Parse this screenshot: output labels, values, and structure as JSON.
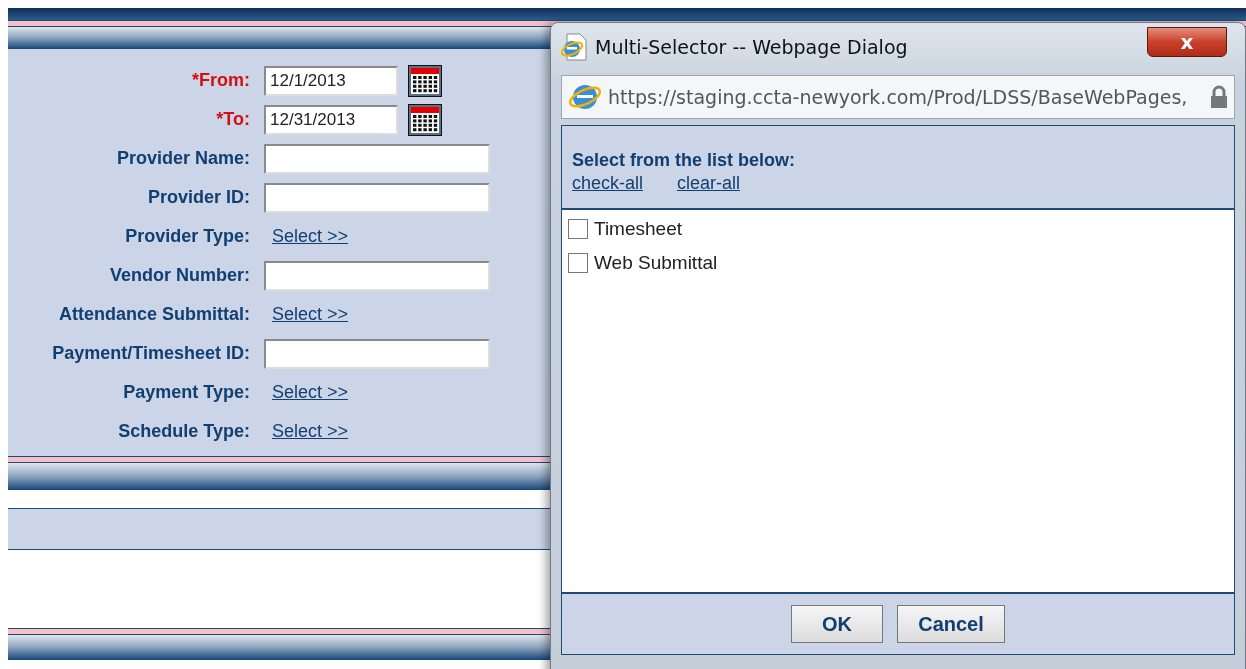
{
  "form": {
    "fields": [
      {
        "label": "*From:",
        "required": true,
        "kind": "date",
        "value": "12/1/2013"
      },
      {
        "label": "*To:",
        "required": true,
        "kind": "date",
        "value": "12/31/2013"
      },
      {
        "label": "Provider Name:",
        "required": false,
        "kind": "text"
      },
      {
        "label": "Provider ID:",
        "required": false,
        "kind": "text"
      },
      {
        "label": "Provider Type:",
        "required": false,
        "kind": "select",
        "link": "Select >>"
      },
      {
        "label": "Vendor Number:",
        "required": false,
        "kind": "text"
      },
      {
        "label": "Attendance Submittal:",
        "required": false,
        "kind": "select",
        "link": "Select >>"
      },
      {
        "label": "Payment/Timesheet ID:",
        "required": false,
        "kind": "text"
      },
      {
        "label": "Payment Type:",
        "required": false,
        "kind": "select",
        "link": "Select >>"
      },
      {
        "label": "Schedule Type:",
        "required": false,
        "kind": "select",
        "link": "Select >>"
      }
    ]
  },
  "dialog": {
    "title": "Multi-Selector -- Webpage Dialog",
    "close": "x",
    "url": "https://staging.ccta-newyork.com/Prod/LDSS/BaseWebPages,",
    "instruction": "Select from the list below:",
    "links": [
      "check-all",
      "clear-all"
    ],
    "items": [
      {
        "label": "Timesheet",
        "checked": false
      },
      {
        "label": "Web Submittal",
        "checked": false
      }
    ],
    "buttons": [
      "OK",
      "Cancel"
    ]
  }
}
